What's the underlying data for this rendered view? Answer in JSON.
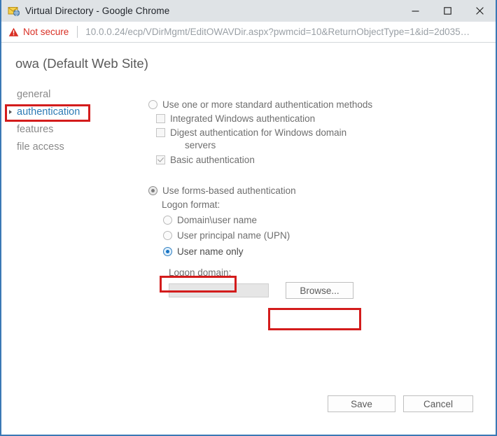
{
  "window": {
    "title": "Virtual Directory - Google Chrome",
    "favicon_icon": "envelope-globe-icon",
    "minimize_label": "—",
    "maximize_label": "☐",
    "close_label": "✕"
  },
  "omnibox": {
    "security_icon": "warning-triangle-icon",
    "security_text": "Not secure",
    "url": "10.0.0.24/ecp/VDirMgmt/EditOWAVDir.aspx?pwmcid=10&ReturnObjectType=1&id=2d035…"
  },
  "page": {
    "title": "owa (Default Web Site)"
  },
  "nav": {
    "items": [
      {
        "label": "general",
        "selected": false
      },
      {
        "label": "authentication",
        "selected": true
      },
      {
        "label": "features",
        "selected": false
      },
      {
        "label": "file access",
        "selected": false
      }
    ]
  },
  "form": {
    "standard_auth": {
      "radio_label": "Use one or more standard authentication methods",
      "radio_checked": false,
      "options": [
        {
          "label": "Integrated Windows authentication",
          "checked": false
        },
        {
          "label": "Digest authentication for Windows domain",
          "label_line2": "servers",
          "checked": false
        },
        {
          "label": "Basic authentication",
          "checked": true
        }
      ]
    },
    "forms_auth": {
      "radio_label": "Use forms-based authentication",
      "radio_checked": true,
      "logon_format_label": "Logon format:",
      "options": [
        {
          "label": "Domain\\user name",
          "checked": false
        },
        {
          "label": "User principal name (UPN)",
          "checked": false
        },
        {
          "label": "User name only",
          "checked": true
        }
      ],
      "logon_domain_label": "Logon domain:",
      "logon_domain_value": "",
      "logon_domain_placeholder": "",
      "browse_label": "Browse..."
    }
  },
  "footer": {
    "save_label": "Save",
    "cancel_label": "Cancel"
  },
  "highlights": {
    "color": "#d31c1c",
    "targets": [
      "authentication",
      "User name only",
      "Browse..."
    ]
  }
}
